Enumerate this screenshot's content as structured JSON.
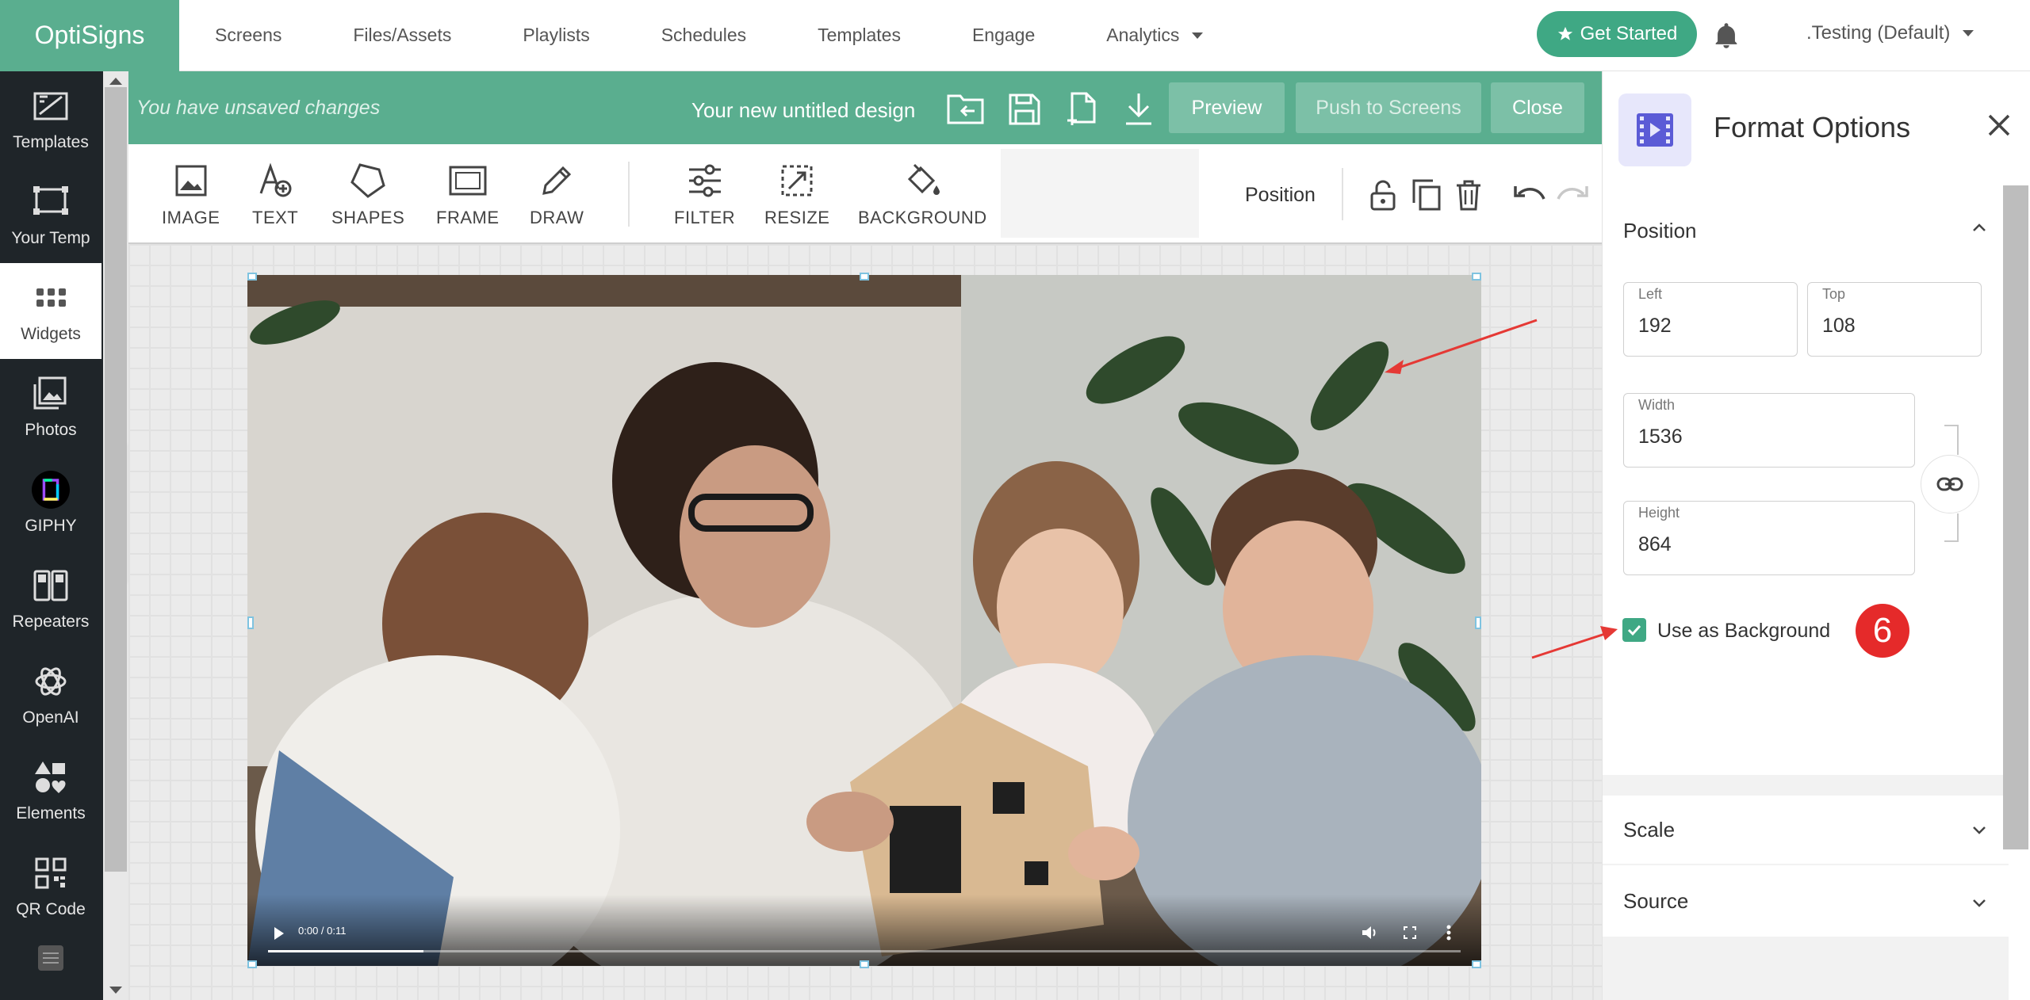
{
  "brand": "OptiSigns",
  "nav": {
    "links": [
      "Screens",
      "Files/Assets",
      "Playlists",
      "Schedules",
      "Templates",
      "Engage",
      "Analytics"
    ],
    "get_started": "Get Started",
    "account": ".Testing (Default)"
  },
  "sidebar": {
    "items": [
      {
        "label": "Templates",
        "icon": "templates-icon"
      },
      {
        "label": "Your Temp",
        "icon": "your-templates-icon"
      },
      {
        "label": "Widgets",
        "icon": "widgets-icon"
      },
      {
        "label": "Photos",
        "icon": "photos-icon"
      },
      {
        "label": "GIPHY",
        "icon": "giphy-icon"
      },
      {
        "label": "Repeaters",
        "icon": "repeaters-icon"
      },
      {
        "label": "OpenAI",
        "icon": "openai-icon"
      },
      {
        "label": "Elements",
        "icon": "elements-icon"
      },
      {
        "label": "QR Code",
        "icon": "qr-code-icon"
      }
    ]
  },
  "editor": {
    "unsaved": "You have unsaved changes",
    "title": "Your new untitled design",
    "preview": "Preview",
    "push": "Push to Screens",
    "close": "Close"
  },
  "toolbar": {
    "tools": [
      "IMAGE",
      "TEXT",
      "SHAPES",
      "FRAME",
      "DRAW",
      "FILTER",
      "RESIZE",
      "BACKGROUND"
    ],
    "position": "Position"
  },
  "video": {
    "time": "0:00 / 0:11",
    "progress": 0.13
  },
  "panel": {
    "title": "Format Options",
    "position_section": "Position",
    "left_label": "Left",
    "left_value": "192",
    "top_label": "Top",
    "top_value": "108",
    "width_label": "Width",
    "width_value": "1536",
    "height_label": "Height",
    "height_value": "864",
    "use_as_background": "Use as Background",
    "use_as_background_checked": true,
    "badge": "6",
    "scale_section": "Scale",
    "source_section": "Source"
  },
  "colors": {
    "brand_green": "#5aae8f",
    "accent": "#3fa884",
    "badge_red": "#e52a2a",
    "annotation_red": "#e53935"
  }
}
